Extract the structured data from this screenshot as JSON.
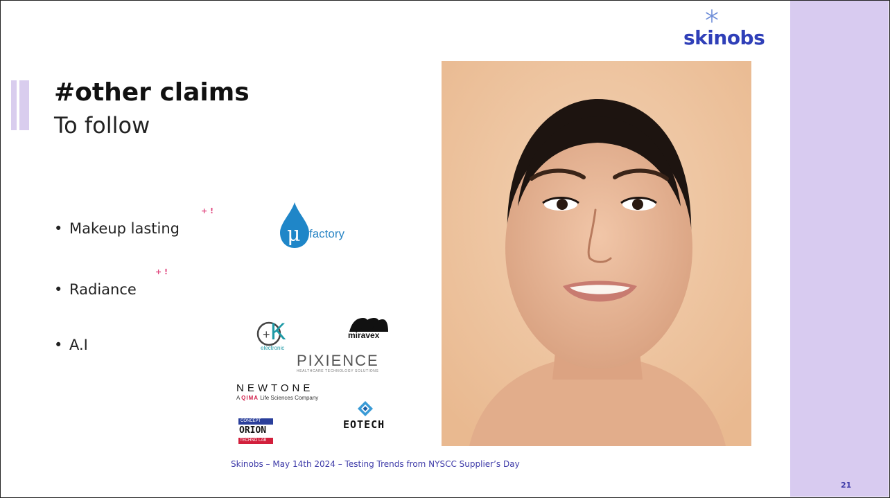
{
  "slide": {
    "title": "#other claims",
    "subtitle": "To follow",
    "bullets": [
      {
        "text": "Makeup lasting",
        "sup": "+ !"
      },
      {
        "text": "Radiance",
        "sup": "+ !"
      },
      {
        "text": "A.I"
      }
    ],
    "footer": "Skinobs – May 14th 2024 – Testing Trends from NYSCC Supplier’s Day",
    "page_number": "21"
  },
  "brand": {
    "logo_text": "skinobs",
    "logo_color": "#2f3fb8"
  },
  "partner_logos": {
    "ufactory": "factory",
    "ck_letter": "K",
    "ck_sub": "electronic",
    "miravex": "miravex",
    "pixience": "PIXIENCE",
    "pixience_tagline": "HEALTHCARE TECHNOLOGY SOLUTIONS",
    "newtone": "NEWTONE",
    "newtone_tagline_a": "A",
    "newtone_tagline_qima": "QIMA",
    "newtone_tagline_b": "Life Sciences Company",
    "orion_top": "CONCEPT",
    "orion_mid": "ORION",
    "orion_bot": "TECHNO LAB",
    "eotech": "EOTECH"
  },
  "colors": {
    "sidebar": "#d8cbf0",
    "accent": "#e0467e",
    "footer_text": "#3d3aa8"
  }
}
